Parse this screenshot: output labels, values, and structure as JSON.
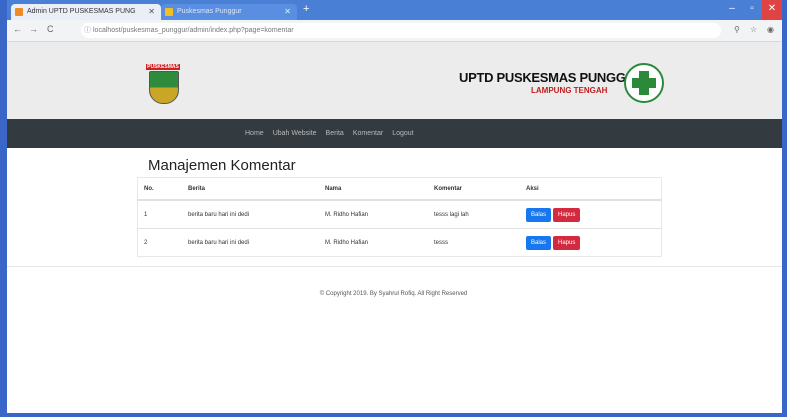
{
  "browser": {
    "tab1_title": "Admin UPTD PUSKESMAS PUNG",
    "tab2_title": "Puskesmas Punggur",
    "url": "localhost/puskesmas_punggur/admin/index.php?page=komentar"
  },
  "header": {
    "crest_label": "PUSKESMAS",
    "title": "UPTD PUSKESMAS PUNGGUR",
    "subtitle": "LAMPUNG TENGAH"
  },
  "nav": {
    "items": [
      {
        "label": "Home"
      },
      {
        "label": "Ubah Website"
      },
      {
        "label": "Berita"
      },
      {
        "label": "Komentar"
      },
      {
        "label": "Logout"
      }
    ]
  },
  "main": {
    "title": "Manajemen Komentar",
    "columns": [
      "No.",
      "Berita",
      "Nama",
      "Komentar",
      "Aksi"
    ],
    "rows": [
      {
        "no": "1",
        "berita": "berita baru hari ini dedi",
        "nama": "M. Ridho Hafian",
        "komentar": "tesss lagi lah",
        "edit": "Balas",
        "delete": "Hapus"
      },
      {
        "no": "2",
        "berita": "berita baru hari ini dedi",
        "nama": "M. Ridho Hafian",
        "komentar": "tesss",
        "edit": "Balas",
        "delete": "Hapus"
      }
    ]
  },
  "footer": {
    "text": "© Copyright 2019. By Syahrul Rofiq. All Right Reserved"
  },
  "colors": {
    "navbar": "#333a40",
    "edit_button": "#1677ef",
    "delete_button": "#d42a3f",
    "browser_accent": "#3a66c8"
  }
}
